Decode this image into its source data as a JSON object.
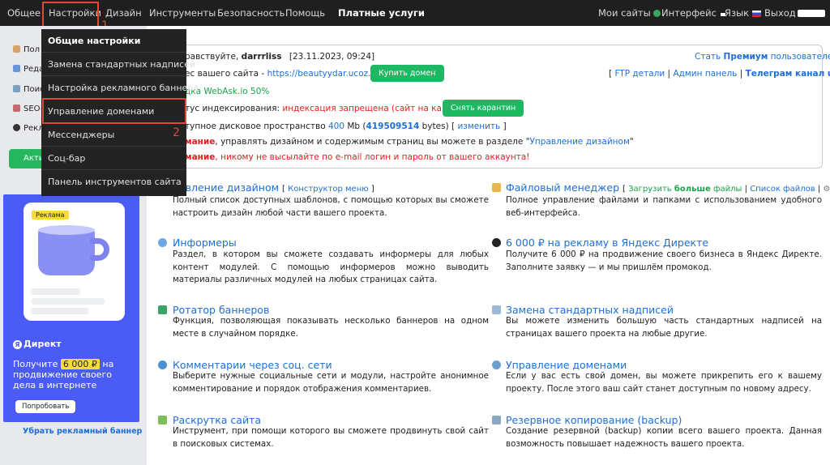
{
  "topnav": {
    "items": [
      "Общее",
      "Настройки",
      "Дизайн",
      "Инструменты",
      "Безопасность",
      "Помощь"
    ],
    "paid": "Платные услуги",
    "my_sites": "Мои сайты",
    "interface": "Интерфейс",
    "language": "Язык",
    "logout": "Выход"
  },
  "annotations": {
    "one": "1",
    "two": "2"
  },
  "dropdown": {
    "header": "Общие настройки",
    "items": [
      "Замена стандартных надписей",
      "Настройка рекламного баннера",
      "Управление доменами",
      "Мессенджеры",
      "Соц-бар",
      "Панель инструментов сайта"
    ]
  },
  "sidebar": {
    "items": [
      "Пол",
      "Реда",
      "Поис",
      "SEO-",
      "Рекл"
    ],
    "button": "Акти"
  },
  "ad": {
    "tag": "Реклама",
    "brand": "Директ",
    "text_prefix": "Получите",
    "price": "6 000 ₽",
    "text_suffix": "на продвижение своего дела в интернете",
    "button": "Попробовать",
    "remove": "Убрать рекламный баннер"
  },
  "info": {
    "greeting": "равствуйте,",
    "username": "darrrliss",
    "datetime": "[23.11.2023, 09:24]",
    "premium_prefix": "Стать",
    "premium": "Премиум",
    "premium_suffix": "пользователем",
    "address_label": "ес вашего сайта -",
    "address_url": "https://beautyydar.ucoz.net/",
    "buy_domain": "Купить домен",
    "bracket_open": "[",
    "ftp": "FTP детали",
    "admin_panel": "Админ панель",
    "telegram": "Телеграм канал uCoz",
    "bracket_close": "]",
    "sep": "|",
    "webask": "дка WebAsk.io 50%",
    "index_label": "тус индексирования:",
    "index_status": "индексация запрещена (сайт на карантине)",
    "remove_quarantine": "Снять карантин",
    "disk_label": "тупное дисковое пространство",
    "disk_mb": "400",
    "disk_mb_unit": "Mb (",
    "disk_bytes": "419509514",
    "disk_bytes_unit": "bytes) [",
    "disk_change": "изменить",
    "disk_close": "]",
    "note1_bold": "мание",
    "note1_text": ", управлять дизайном и содержимым страниц вы можете в разделе \"",
    "note1_link": "Управление дизайном",
    "note1_end": "\"",
    "note2_bold": "мание",
    "note2_text": ", никому не высылайте по e-mail логин и пароль от вашего аккаунта!"
  },
  "sections": {
    "design": {
      "title": "равление дизайном",
      "extra": "Конструктор меню",
      "desc": "Полный список доступных шаблонов, с помощью которых вы сможете настроить дизайн любой части вашего проекта."
    },
    "files": {
      "title": "Файловый менеджер",
      "upload_prefix": "Загрузить",
      "upload_bold": "больше",
      "upload_suffix": "файлы",
      "list": "Список файлов",
      "desc": "Полное управление файлами и папками с использованием удобного веб-интерфейса."
    },
    "informers": {
      "title": "Информеры",
      "desc": "Раздел, в котором вы сможете создавать информеры для любых контент модулей. С помощью информеров можно выводить материалы различных модулей на любых страницах сайта."
    },
    "yandex": {
      "title": "6 000 ₽ на рекламу в Яндекс Директе",
      "desc": "Получите 6 000 ₽ на продвижение своего бизнеса в Яндекс Директе. Заполните заявку — и мы пришлём промокод."
    },
    "rotator": {
      "title": "Ротатор баннеров",
      "desc": "Функция, позволяющая показывать несколько баннеров на одном месте в случайном порядке."
    },
    "replace": {
      "title": "Замена стандартных надписей",
      "desc": "Вы можете изменить большую часть стандартных надписей на страницах вашего проекта на любые другие."
    },
    "comments": {
      "title": "Комментарии через соц. сети",
      "desc": "Выберите нужные социальные сети и модули, настройте анонимное комментирование и порядок отображения комментариев."
    },
    "domains": {
      "title": "Управление доменами",
      "desc": "Если у вас есть свой домен, вы можете прикрепить его к вашему проекту. После этого ваш сайт станет доступным по новому адресу."
    },
    "promo": {
      "title": "Раскрутка сайта",
      "desc": "Инструмент, при помощи которого вы сможете продвинуть свой сайт в поисковых системах."
    },
    "backup": {
      "title": "Резервное копирование (backup)",
      "desc": "Создание резервной (backup) копии всего вашего проекта. Данная возможность повышает надежность вашего проекта."
    }
  },
  "colors": {
    "accent": "#1d6fd6",
    "green": "#1fb862",
    "red": "#e02020",
    "highlight": "#e0483b",
    "ad_bg": "#4a5cf5"
  }
}
